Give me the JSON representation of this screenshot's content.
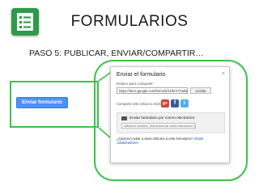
{
  "slide": {
    "title": "FORMULARIOS",
    "subtitle": "PASO 5: PUBLICAR, ENVIAR/COMPARTIR…",
    "cta_button_label": "Enviar formulario"
  },
  "dialog": {
    "title": "Enviar el formulario",
    "close_glyph": "×",
    "share_link_label": "Enlace para compartir",
    "share_url": "https://docs.google.com/forms/d/1DfeX7TaskRH",
    "shorten_label": "Acortar",
    "share_via_text": "Compartir este enlace a través de:",
    "email_section_title": "Enviar formulario por correo electrónico",
    "email_placeholder": "Introducir nombres, direcciones de correo electrónico o grupos",
    "footer_prefix": "¿Quieres invitar a otros editores a este formulario?",
    "footer_link": "Añadir colaboradores"
  },
  "social": [
    {
      "name": "google-plus",
      "glyph": "g+",
      "color": "#d34836"
    },
    {
      "name": "facebook",
      "glyph": "f",
      "color": "#3b5998"
    },
    {
      "name": "twitter",
      "glyph": "t",
      "color": "#55acee"
    }
  ],
  "accent_colors": {
    "highlight_green": "#3cc24a",
    "logo_green": "#2e9a4a",
    "button_blue": "#4d90fe"
  },
  "icons": [
    "google-forms-logo-icon",
    "envelope-icon",
    "close-icon",
    "arrow-icon"
  ]
}
